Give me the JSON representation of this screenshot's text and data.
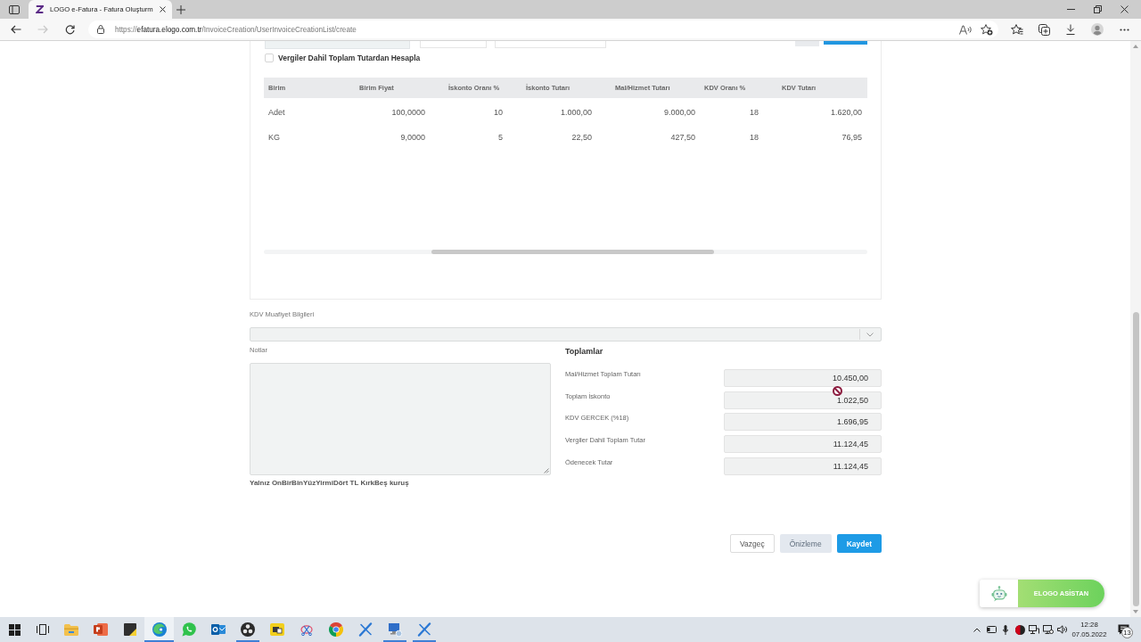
{
  "browser": {
    "tabs": [
      {
        "title": "LOGO e-Fatura - Fatura Oluşturm",
        "selected": true
      }
    ],
    "nav_buttons": [
      {
        "kind": "back",
        "disabled": false
      },
      {
        "kind": "forward",
        "disabled": true
      },
      {
        "kind": "refresh",
        "disabled": false
      }
    ],
    "url": {
      "scheme": "https://",
      "host": "efatura.elogo.com.tr",
      "path": "/InvoiceCreation/UserInvoiceCreationList/create"
    }
  },
  "invoice": {
    "vat_inclusive": {
      "label": "Vergiler Dahil Toplam Tutardan Hesapla",
      "checked": false
    },
    "lines_table": {
      "columns": [
        "Birim",
        "Birim Fiyat",
        "İskonto Oranı %",
        "İskonto Tutarı",
        "Mal/Hizmet Tutarı",
        "KDV Oranı %",
        "KDV Tutarı"
      ],
      "rows": [
        [
          "Adet",
          "100,0000",
          "10",
          "1.000,00",
          "9.000,00",
          "18",
          "1.620,00"
        ],
        [
          "KG",
          "9,0000",
          "5",
          "22,50",
          "427,50",
          "18",
          "76,95"
        ]
      ]
    },
    "exemption": {
      "label": "KDV Muafiyet Bilgileri"
    },
    "notes": {
      "label": "Notlar",
      "amount_in_words": "Yalnız OnBirBinYüzYirmiDört TL KırkBeş kuruş"
    },
    "totals": {
      "title": "Toplamlar",
      "rows": [
        {
          "label": "Mal/Hizmet Toplam Tutarı",
          "value": "10.450,00"
        },
        {
          "label": "Toplam İskonto",
          "value": "1.022,50"
        },
        {
          "label": "KDV GERCEK (%18)",
          "value": "1.696,95"
        },
        {
          "label": "Vergiler Dahil Toplam Tutar",
          "value": "11.124,45"
        },
        {
          "label": "Ödenecek Tutar",
          "value": "11.124,45"
        }
      ]
    },
    "buttons": [
      {
        "label": "Vazgeç",
        "kind": "cancel"
      },
      {
        "label": "Önizleme",
        "kind": "preview"
      },
      {
        "label": "Kaydet",
        "kind": "save"
      }
    ]
  },
  "assistant": {
    "label": "ELOGO ASİSTAN"
  },
  "taskbar": {
    "apps": [
      {
        "kind": "folder",
        "running": false,
        "selected": false
      },
      {
        "kind": "slides",
        "running": false,
        "selected": false
      },
      {
        "kind": "note",
        "running": false,
        "selected": false
      },
      {
        "kind": "swirl_browser",
        "running": true,
        "selected": true
      },
      {
        "kind": "chat",
        "running": false,
        "selected": false
      },
      {
        "kind": "mail",
        "running": false,
        "selected": false
      },
      {
        "kind": "recorder",
        "running": true,
        "selected": false
      },
      {
        "kind": "tile",
        "running": false,
        "selected": false
      },
      {
        "kind": "scissors",
        "running": false,
        "selected": false
      },
      {
        "kind": "ring_browser",
        "running": false,
        "selected": false
      },
      {
        "kind": "cross",
        "running": false,
        "selected": false
      },
      {
        "kind": "monitor",
        "running": true,
        "selected": false
      },
      {
        "kind": "cross",
        "running": true,
        "selected": false
      }
    ],
    "clock": {
      "time": "12:28",
      "date": "07.05.2022"
    },
    "notification_count": "13"
  }
}
